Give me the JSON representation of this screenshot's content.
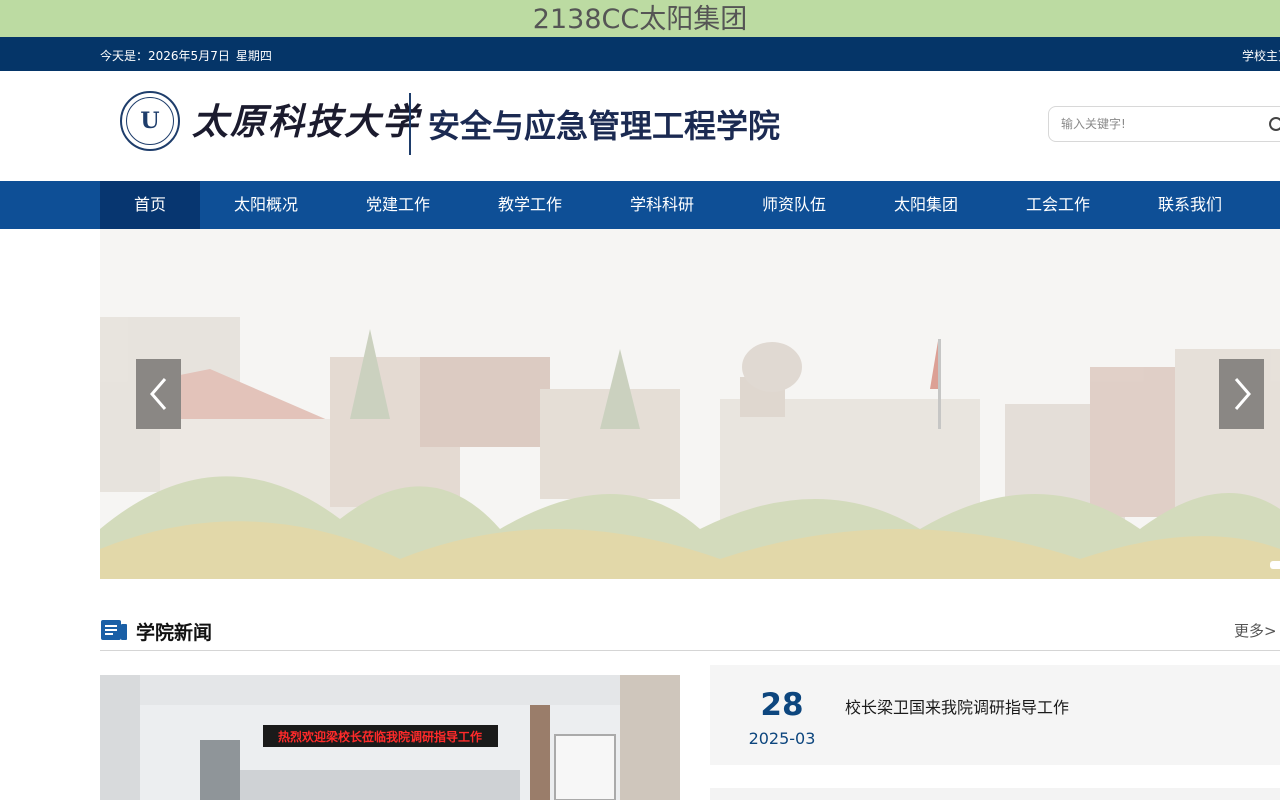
{
  "top_banner": {
    "text": "2138CC太阳集团"
  },
  "info_bar": {
    "date_label": "今天是：",
    "date": "2026年5月7日",
    "weekday": "星期四",
    "right_link": "学校主页"
  },
  "header": {
    "university_name": "太原科技大学",
    "college_name": "安全与应急管理工程学院",
    "emblem_letter": "U"
  },
  "search": {
    "placeholder": "输入关键字!"
  },
  "nav": {
    "items": [
      {
        "label": "首页",
        "active": true
      },
      {
        "label": "太阳概况"
      },
      {
        "label": "党建工作"
      },
      {
        "label": "教学工作"
      },
      {
        "label": "学科科研"
      },
      {
        "label": "师资队伍"
      },
      {
        "label": "太阳集团"
      },
      {
        "label": "工会工作"
      },
      {
        "label": "联系我们"
      }
    ]
  },
  "news": {
    "section_title": "学院新闻",
    "more_label": "更多>",
    "photo_banner_text": "热烈欢迎梁校长莅临我院调研指导工作",
    "items": [
      {
        "day": "28",
        "month": "2025-03",
        "title": "校长梁卫国来我院调研指导工作"
      }
    ]
  },
  "colors": {
    "banner_bg": "#bcdba2",
    "top_bar": "#053568",
    "nav_bg": "#0e4f96",
    "nav_active": "#073670",
    "accent_text": "#0d467e"
  }
}
